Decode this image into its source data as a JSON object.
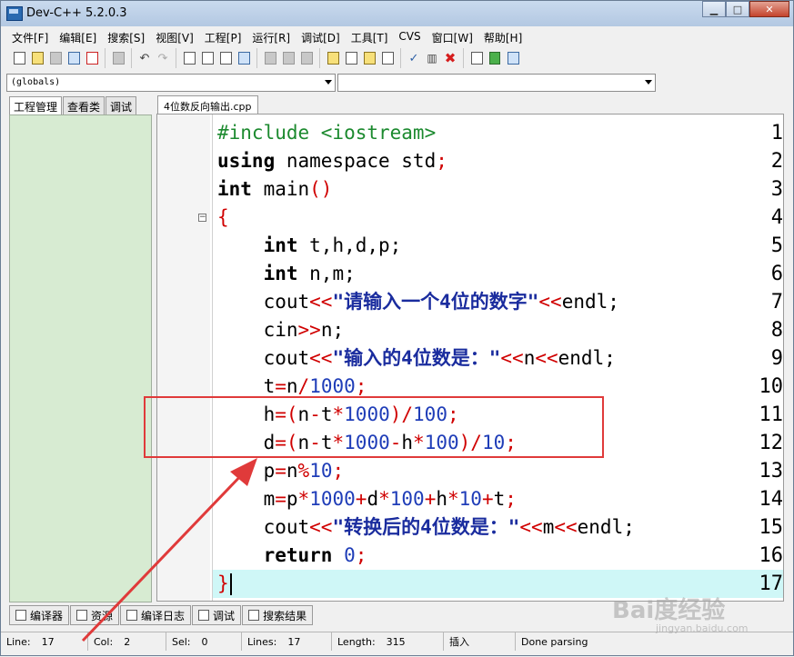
{
  "window": {
    "title": "Dev-C++ 5.2.0.3"
  },
  "menu": [
    "文件[F]",
    "编辑[E]",
    "搜索[S]",
    "视图[V]",
    "工程[P]",
    "运行[R]",
    "调试[D]",
    "工具[T]",
    "CVS",
    "窗口[W]",
    "帮助[H]"
  ],
  "toolbar_icons": [
    "new-file-icon",
    "open-icon",
    "save-icon",
    "save-all-icon",
    "close-file-icon",
    "print-icon",
    "undo-icon",
    "redo-icon",
    "find-icon",
    "find-next-icon",
    "replace-icon",
    "goto-icon",
    "bookmark-prev-icon",
    "bookmark-next-icon",
    "toggle-bookmark-icon",
    "class-browser-icon",
    "project-view-icon",
    "toolbar-view-icon",
    "grid-icon",
    "compile-icon",
    "chart-icon",
    "stop-icon",
    "new-project-icon",
    "add-file-icon",
    "remove-file-icon"
  ],
  "combos": {
    "scope": "(globals)",
    "function": ""
  },
  "left_tabs": [
    "工程管理",
    "查看类",
    "调试"
  ],
  "editor": {
    "file_tab": "4位数反向输出.cpp",
    "line_numbers": [
      "1",
      "2",
      "3",
      "4",
      "5",
      "6",
      "7",
      "8",
      "9",
      "10",
      "11",
      "12",
      "13",
      "14",
      "15",
      "16",
      "17"
    ]
  },
  "bottom_tabs": [
    "编译器",
    "资源",
    "编译日志",
    "调试",
    "搜索结果"
  ],
  "status": {
    "line_label": "Line:",
    "line_value": "17",
    "col_label": "Col:",
    "col_value": "2",
    "sel_label": "Sel:",
    "sel_value": "0",
    "lines_label": "Lines:",
    "lines_value": "17",
    "length_label": "Length:",
    "length_value": "315",
    "mode": "插入",
    "message": "Done parsing"
  },
  "watermark": {
    "text": "Bai度经验",
    "sub": "jingyan.baidu.com"
  },
  "colors": {
    "current_line": "#cff7f7",
    "annotation": "#e03a3a",
    "left_panel": "#d7ebd2"
  }
}
